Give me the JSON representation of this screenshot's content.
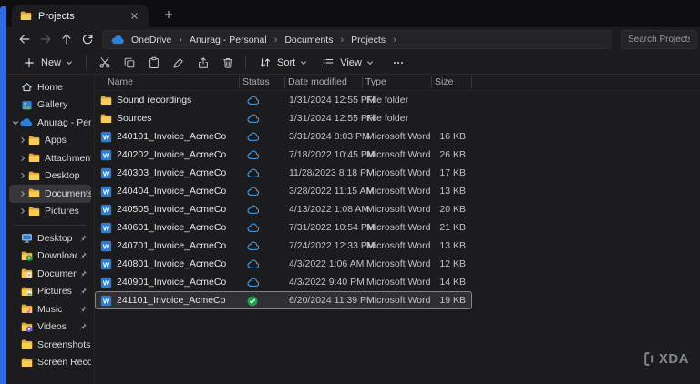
{
  "window": {
    "tab_title": "Projects"
  },
  "nav": {
    "breadcrumb": [
      "OneDrive",
      "Anurag - Personal",
      "Documents",
      "Projects"
    ],
    "separator_glyph": "›",
    "search_placeholder": "Search Projects"
  },
  "toolbar": {
    "new_label": "New",
    "sort_label": "Sort",
    "view_label": "View"
  },
  "sidebar": {
    "items": [
      {
        "label": "Home",
        "icon": "home"
      },
      {
        "label": "Gallery",
        "icon": "gallery"
      },
      {
        "label": "Anurag - Person",
        "icon": "onedrive",
        "chevron": "down"
      },
      {
        "label": "Apps",
        "icon": "folder",
        "chevron": "right",
        "indent": true
      },
      {
        "label": "Attachments",
        "icon": "folder",
        "chevron": "right",
        "indent": true
      },
      {
        "label": "Desktop",
        "icon": "folder",
        "chevron": "right",
        "indent": true
      },
      {
        "label": "Documents",
        "icon": "folder",
        "chevron": "right",
        "indent": true,
        "selected": true
      },
      {
        "label": "Pictures",
        "icon": "folder",
        "chevron": "right",
        "indent": true
      },
      {
        "separator": true
      },
      {
        "label": "Desktop",
        "icon": "desktop",
        "pinned": true
      },
      {
        "label": "Downloads",
        "icon": "downloads",
        "pinned": true
      },
      {
        "label": "Documents",
        "icon": "documents",
        "pinned": true
      },
      {
        "label": "Pictures",
        "icon": "pictures",
        "pinned": true
      },
      {
        "label": "Music",
        "icon": "music",
        "pinned": true
      },
      {
        "label": "Videos",
        "icon": "videos",
        "pinned": true
      },
      {
        "label": "Screenshots",
        "icon": "folder"
      },
      {
        "label": "Screen Recordin",
        "icon": "folder"
      }
    ]
  },
  "files": {
    "columns": [
      "Name",
      "Status",
      "Date modified",
      "Type",
      "Size"
    ],
    "rows": [
      {
        "name": "Sound recordings",
        "icon": "folder",
        "status": "cloud",
        "modified": "1/31/2024 12:55 PM",
        "type": "File folder",
        "size": ""
      },
      {
        "name": "Sources",
        "icon": "folder",
        "status": "cloud",
        "modified": "1/31/2024 12:55 PM",
        "type": "File folder",
        "size": ""
      },
      {
        "name": "240101_Invoice_AcmeCo",
        "icon": "word",
        "status": "cloud",
        "modified": "3/31/2024 8:03 PM",
        "type": "Microsoft Word D...",
        "size": "16 KB"
      },
      {
        "name": "240202_Invoice_AcmeCo",
        "icon": "word",
        "status": "cloud",
        "modified": "7/18/2022 10:45 PM",
        "type": "Microsoft Word D...",
        "size": "26 KB"
      },
      {
        "name": "240303_Invoice_AcmeCo",
        "icon": "word",
        "status": "cloud",
        "modified": "11/28/2023 8:18 PM",
        "type": "Microsoft Word D...",
        "size": "17 KB"
      },
      {
        "name": "240404_Invoice_AcmeCo",
        "icon": "word",
        "status": "cloud",
        "modified": "3/28/2022 11:15 AM",
        "type": "Microsoft Word D...",
        "size": "13 KB"
      },
      {
        "name": "240505_Invoice_AcmeCo",
        "icon": "word",
        "status": "cloud",
        "modified": "4/13/2022 1:08 AM",
        "type": "Microsoft Word D...",
        "size": "20 KB"
      },
      {
        "name": "240601_Invoice_AcmeCo",
        "icon": "word",
        "status": "cloud",
        "modified": "7/31/2022 10:54 PM",
        "type": "Microsoft Word D...",
        "size": "21 KB"
      },
      {
        "name": "240701_Invoice_AcmeCo",
        "icon": "word",
        "status": "cloud",
        "modified": "7/24/2022 12:33 PM",
        "type": "Microsoft Word D...",
        "size": "13 KB"
      },
      {
        "name": "240801_Invoice_AcmeCo",
        "icon": "word",
        "status": "cloud",
        "modified": "4/3/2022 1:06 AM",
        "type": "Microsoft Word D...",
        "size": "12 KB"
      },
      {
        "name": "240901_Invoice_AcmeCo",
        "icon": "word",
        "status": "cloud",
        "modified": "4/3/2022 9:40 PM",
        "type": "Microsoft Word D...",
        "size": "14 KB"
      },
      {
        "name": "241101_Invoice_AcmeCo",
        "icon": "word",
        "status": "synced",
        "modified": "6/20/2024 11:39 PM",
        "type": "Microsoft Word D...",
        "size": "19 KB",
        "selected": true
      }
    ]
  },
  "colors": {
    "accent_strip": "#2e6be5",
    "cloud_status": "#4ba0e8",
    "synced_status": "#1e9e4a",
    "folder": "#f7cd56",
    "word": "#2b7cd3"
  },
  "watermark": {
    "text": "XDA"
  }
}
